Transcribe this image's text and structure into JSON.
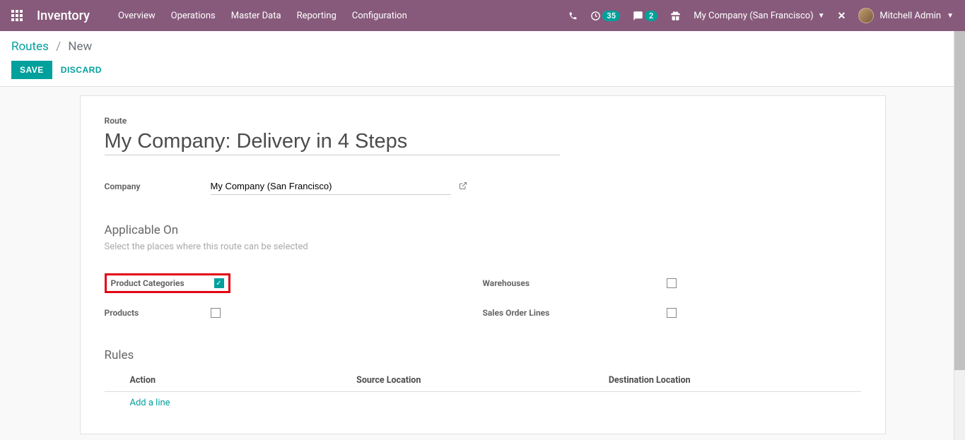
{
  "navbar": {
    "brand": "Inventory",
    "menu": [
      "Overview",
      "Operations",
      "Master Data",
      "Reporting",
      "Configuration"
    ],
    "activities_count": "35",
    "messages_count": "2",
    "company": "My Company (San Francisco)",
    "user": "Mitchell Admin"
  },
  "breadcrumb": {
    "root": "Routes",
    "current": "New"
  },
  "buttons": {
    "save": "SAVE",
    "discard": "DISCARD"
  },
  "form": {
    "route_label": "Route",
    "route_name": "My Company: Delivery in 4 Steps",
    "company_label": "Company",
    "company_value": "My Company (San Francisco)",
    "applicable_on_title": "Applicable On",
    "applicable_on_help": "Select the places where this route can be selected",
    "options": {
      "product_categories": {
        "label": "Product Categories",
        "checked": true
      },
      "products": {
        "label": "Products",
        "checked": false
      },
      "warehouses": {
        "label": "Warehouses",
        "checked": false
      },
      "sales_order_lines": {
        "label": "Sales Order Lines",
        "checked": false
      }
    },
    "rules": {
      "title": "Rules",
      "columns": [
        "Action",
        "Source Location",
        "Destination Location"
      ],
      "add_line": "Add a line"
    }
  }
}
